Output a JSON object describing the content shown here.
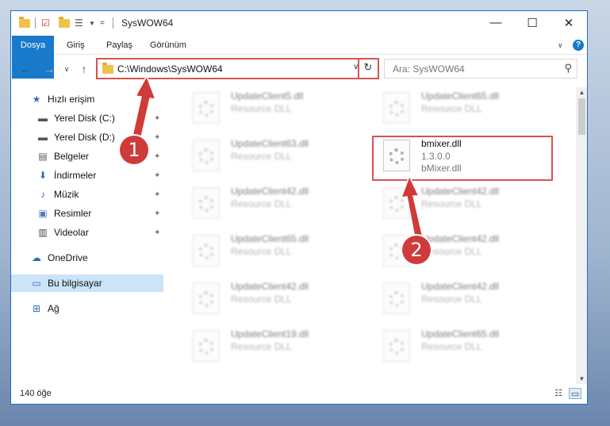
{
  "window": {
    "title": "SysWOW64"
  },
  "ribbon": {
    "tabs": [
      "Dosya",
      "Giriş",
      "Paylaş",
      "Görünüm"
    ]
  },
  "address": {
    "path": "C:\\Windows\\SysWOW64"
  },
  "search": {
    "placeholder": "Ara: SysWOW64"
  },
  "sidebar": {
    "items": [
      {
        "label": "Hızlı erişim",
        "icon": "star-icon"
      },
      {
        "label": "Yerel Disk (C:)",
        "icon": "drive-icon"
      },
      {
        "label": "Yerel Disk (D:)",
        "icon": "drive-icon"
      },
      {
        "label": "Belgeler",
        "icon": "documents-icon"
      },
      {
        "label": "İndirmeler",
        "icon": "download-icon"
      },
      {
        "label": "Müzik",
        "icon": "music-icon"
      },
      {
        "label": "Resimler",
        "icon": "pictures-icon"
      },
      {
        "label": "Videolar",
        "icon": "video-icon"
      },
      {
        "label": "OneDrive",
        "icon": "cloud-icon"
      },
      {
        "label": "Bu bilgisayar",
        "icon": "computer-icon"
      },
      {
        "label": "Ağ",
        "icon": "network-icon"
      }
    ]
  },
  "files": {
    "left": [
      {
        "name": "UpdateClient5.dll",
        "type": "Resource DLL"
      },
      {
        "name": "UpdateClient63.dll",
        "type": "Resource DLL"
      },
      {
        "name": "UpdateClient42.dll",
        "type": "Resource DLL"
      },
      {
        "name": "UpdateClient65.dll",
        "type": "Resource DLL"
      },
      {
        "name": "UpdateClient42.dll",
        "type": "Resource DLL"
      },
      {
        "name": "UpdateClient19.dll",
        "type": "Resource DLL"
      }
    ],
    "right": [
      {
        "name": "UpdateClient65.dll",
        "type": "Resource DLL"
      },
      {
        "name": "UpdateClient42.dll",
        "type": "Resource DLL"
      },
      {
        "name": "UpdateClient42.dll",
        "type": "Resource DLL"
      },
      {
        "name": "UpdateClient42.dll",
        "type": "Resource DLL"
      },
      {
        "name": "UpdateClient65.dll",
        "type": "Resource DLL"
      }
    ],
    "highlighted": {
      "name": "bmixer.dll",
      "version": "1.3.0.0",
      "description": "bMixer.dll"
    }
  },
  "status": {
    "count": "140 öğe"
  },
  "callouts": {
    "one": "1",
    "two": "2"
  },
  "colors": {
    "accent": "#1979ca",
    "callout": "#cf3a3a"
  }
}
